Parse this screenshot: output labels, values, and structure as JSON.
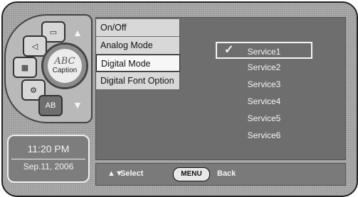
{
  "left_panel": {
    "segments": [
      {
        "icon": "menu-rect-icon"
      },
      {
        "icon": "speaker-icon"
      },
      {
        "icon": "picture-icon"
      },
      {
        "icon": "settings-icon"
      },
      {
        "label": "AB"
      }
    ],
    "knob": {
      "abc": "ABC",
      "label": "Caption"
    },
    "arrows": {
      "up": "▲",
      "down": "▼"
    }
  },
  "clock": {
    "time": "11:20 PM",
    "date": "Sep.11, 2006"
  },
  "menu": {
    "items": [
      {
        "label": "On/Off"
      },
      {
        "label": "Analog Mode"
      },
      {
        "label": "Digital Mode"
      },
      {
        "label": "Digital Font Option"
      }
    ],
    "active_index": 2
  },
  "options": {
    "items": [
      "Service1",
      "Service2",
      "Service3",
      "Service4",
      "Service5",
      "Service6"
    ],
    "selected_index": 0,
    "check": "✓"
  },
  "bottom": {
    "select_arrows": "▲▼",
    "select_label": "Select",
    "menu_key": "MENU",
    "back_label": "Back"
  }
}
